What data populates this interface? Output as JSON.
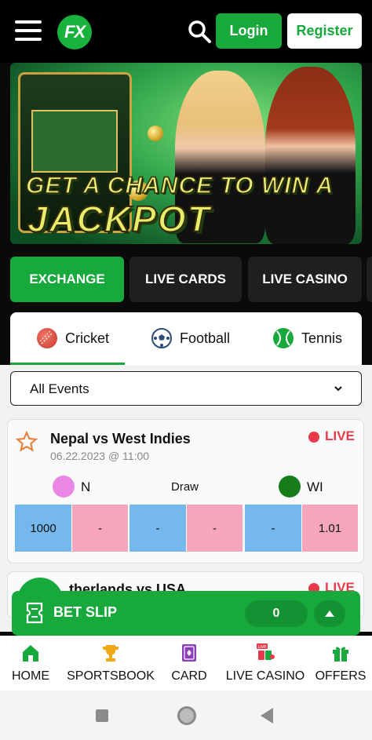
{
  "header": {
    "logo_text": "FX",
    "login_label": "Login",
    "register_label": "Register",
    "colors": {
      "accent": "#17a93b",
      "background": "#000000"
    }
  },
  "banner": {
    "line1": "GET A CHANCE TO WIN A",
    "line2": "JACKPOT"
  },
  "category_tabs": [
    {
      "label": "EXCHANGE",
      "active": true
    },
    {
      "label": "LIVE CARDS",
      "active": false
    },
    {
      "label": "LIVE CASINO",
      "active": false
    }
  ],
  "sport_tabs": [
    {
      "label": "Cricket",
      "icon": "cricket-ball-icon",
      "active": true
    },
    {
      "label": "Football",
      "icon": "football-icon",
      "active": false
    },
    {
      "label": "Tennis",
      "icon": "tennis-ball-icon",
      "active": false
    }
  ],
  "events_filter": {
    "selected": "All Events"
  },
  "matches": [
    {
      "title": "Nepal vs West Indies",
      "date": "06.22.2023 @ 11:00",
      "status": "LIVE",
      "team1": "N",
      "draw": "Draw",
      "team2": "WI",
      "odds": [
        "1000",
        "-",
        "-",
        "-",
        "-",
        "1.01"
      ]
    },
    {
      "title": "therlands vs USA",
      "status": "LIVE"
    }
  ],
  "bet_slip": {
    "label": "BET SLIP",
    "count": "0"
  },
  "bottom_nav": [
    {
      "label": "HOME",
      "icon": "home-icon"
    },
    {
      "label": "SPORTSBOOK",
      "icon": "trophy-icon"
    },
    {
      "label": "CARD",
      "icon": "card-icon"
    },
    {
      "label": "LIVE CASINO",
      "icon": "live-casino-icon"
    },
    {
      "label": "OFFERS",
      "icon": "gift-icon"
    }
  ]
}
